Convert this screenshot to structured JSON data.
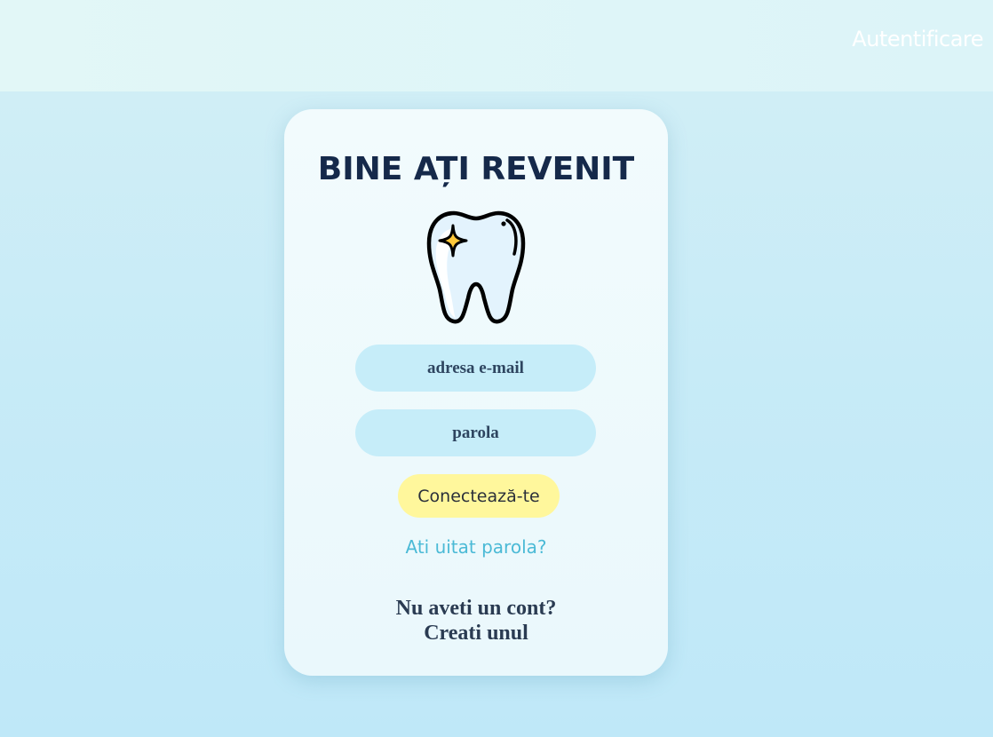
{
  "header": {
    "auth_link_label": "Autentificare"
  },
  "login_card": {
    "title": "BINE AȚI REVENIT",
    "logo_icon": "tooth-sparkle-icon",
    "email_placeholder": "adresa e-mail",
    "password_placeholder": "parola",
    "submit_label": "Conectează-te",
    "forgot_password_label": "Ati uitat parola?",
    "signup_question": "Nu aveti un cont?",
    "signup_link_label": "Creati unul"
  },
  "colors": {
    "title": "#15294a",
    "field_background": "#c6edf9",
    "button_background": "#fff79c",
    "link_accent": "#4bbad6"
  }
}
